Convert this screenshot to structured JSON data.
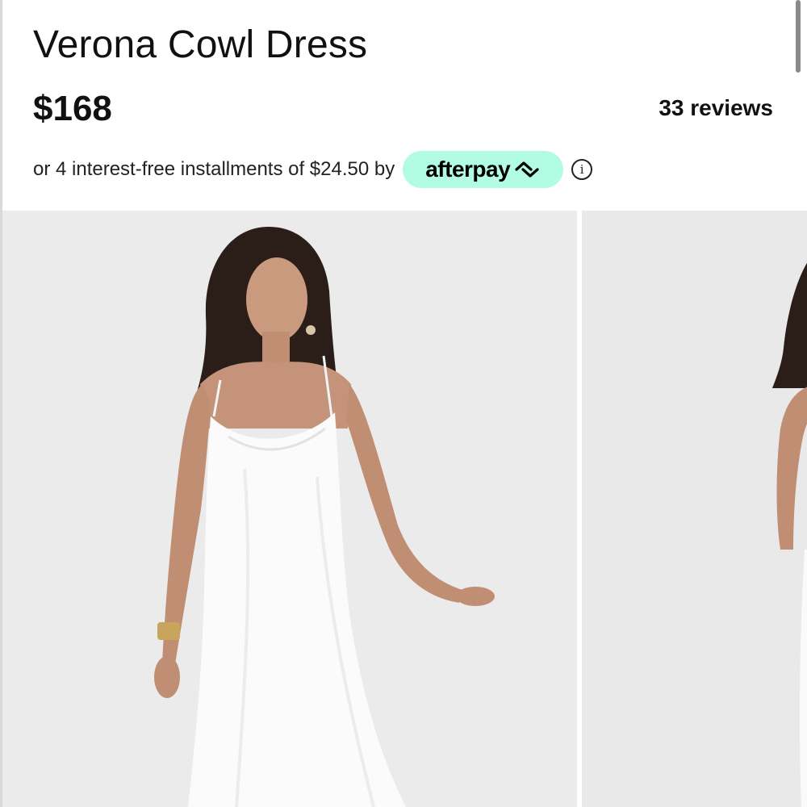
{
  "product": {
    "title": "Verona Cowl Dress",
    "price": "$168",
    "reviews": "33 reviews"
  },
  "payment": {
    "installments_text": "or 4 interest-free installments of $24.50 by",
    "provider": "afterpay",
    "badge_color": "#b2fce4",
    "info_icon": "info-circle-icon"
  },
  "gallery": {
    "images": [
      {
        "alt": "Model wearing white satin cowl neck slip dress"
      },
      {
        "alt": "Back view of white satin slip dress"
      }
    ]
  }
}
